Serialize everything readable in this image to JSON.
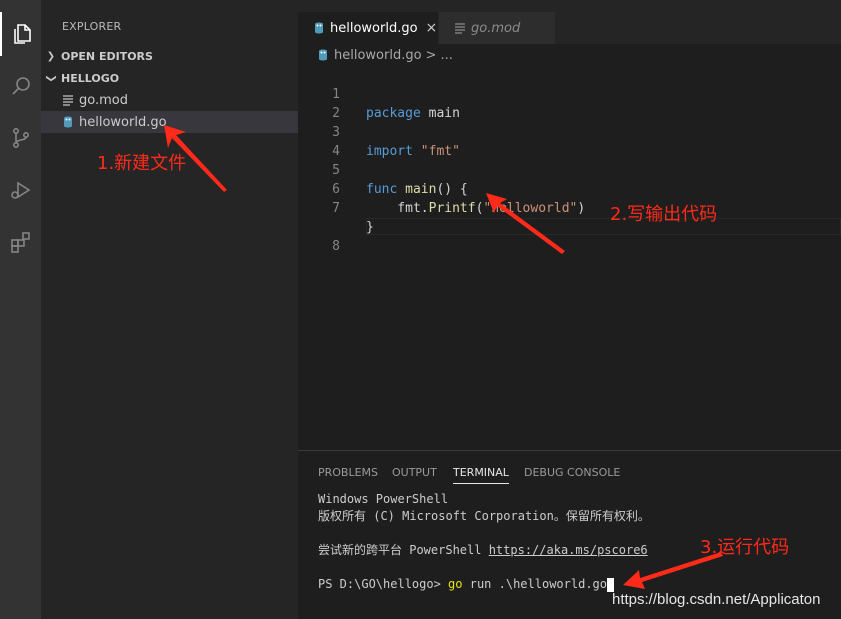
{
  "explorer": {
    "title": "EXPLORER",
    "sections": [
      {
        "label": "OPEN EDITORS",
        "expanded": false
      },
      {
        "label": "HELLOGO",
        "expanded": true
      }
    ],
    "files": [
      {
        "name": "go.mod",
        "icon": "file-lines-icon",
        "selected": false
      },
      {
        "name": "helloworld.go",
        "icon": "go-file-icon",
        "selected": true
      }
    ]
  },
  "activity_bar": {
    "icons": [
      "files-icon",
      "search-icon",
      "source-control-icon",
      "run-debug-icon",
      "extensions-icon"
    ]
  },
  "editor": {
    "tabs": [
      {
        "label": "helloworld.go",
        "active": true,
        "close": "×"
      },
      {
        "label": "go.mod",
        "active": false
      }
    ],
    "breadcrumb": {
      "file": "helloworld.go",
      "sep": ">",
      "more": "..."
    },
    "lines": [
      {
        "n": "1",
        "text": "package main"
      },
      {
        "n": "2",
        "text": ""
      },
      {
        "n": "3",
        "text": "import \"fmt\""
      },
      {
        "n": "4",
        "text": ""
      },
      {
        "n": "5",
        "text": "func main() {"
      },
      {
        "n": "6",
        "text": "    fmt.Printf(\"helloworld\")"
      },
      {
        "n": "7",
        "text": "}"
      },
      {
        "n": "8",
        "text": ""
      }
    ]
  },
  "panel": {
    "tabs": [
      "PROBLEMS",
      "OUTPUT",
      "TERMINAL",
      "DEBUG CONSOLE"
    ],
    "active_tab": "TERMINAL",
    "terminal": {
      "line1": "Windows PowerShell",
      "line2": "版权所有 (C) Microsoft Corporation。保留所有权利。",
      "line3_prefix": "尝试新的跨平台 PowerShell ",
      "line3_link": "https://aka.ms/pscore6",
      "prompt": "PS D:\\GO\\hellogo> ",
      "command": "go",
      "args": " run .\\helloworld.go"
    }
  },
  "annotations": {
    "step1": "1.新建文件",
    "step2": "2.写输出代码",
    "step3": "3.运行代码",
    "color": "#ff2a1a"
  },
  "watermark": "https://blog.csdn.net/Applicaton"
}
